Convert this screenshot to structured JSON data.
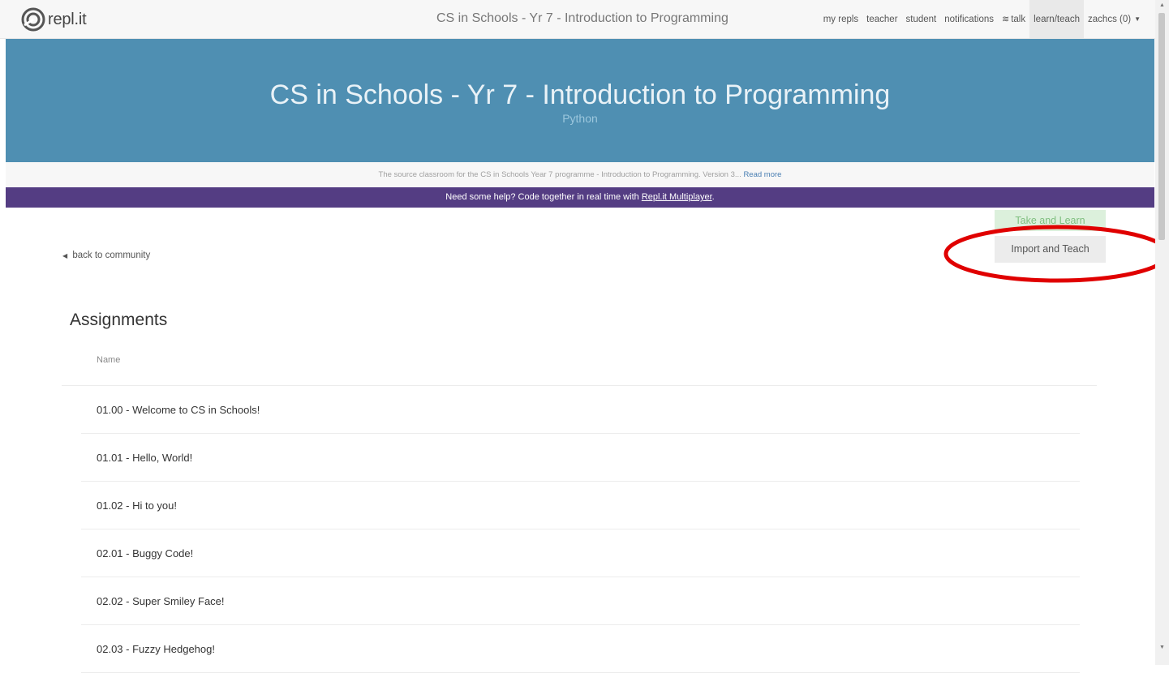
{
  "nav": {
    "logo_text": "repl.it",
    "title": "CS in Schools - Yr 7 - Introduction to Programming",
    "links": [
      {
        "label": "my repls"
      },
      {
        "label": "teacher"
      },
      {
        "label": "student"
      },
      {
        "label": "notifications"
      },
      {
        "label": "talk",
        "icon": "people-icon"
      },
      {
        "label": "learn/teach",
        "active": true
      },
      {
        "label": "zachcs (0)",
        "icon": "caret-down-icon"
      }
    ]
  },
  "hero": {
    "title": "CS in Schools - Yr 7 - Introduction to Programming",
    "language": "Python",
    "background_color": "#4f8fb2"
  },
  "description": {
    "text": "The source classroom for the CS in Schools Year 7 programme - Introduction to Programming. Version 3...",
    "read_more": "Read more"
  },
  "banner": {
    "text": "Need some help? Code together in real time with ",
    "link": "Repl.it Multiplayer",
    "suffix": ".",
    "background_color": "#543d83"
  },
  "actions": {
    "take_and_learn": "Take and Learn",
    "import_and_teach": "Import and Teach",
    "highlight_color": "#e00000"
  },
  "back_link": "back to community",
  "assignments": {
    "title": "Assignments",
    "column_name": "Name",
    "items": [
      "01.00 - Welcome to CS in Schools!",
      "01.01 - Hello, World!",
      "01.02 - Hi to you!",
      "02.01 - Buggy Code!",
      "02.02 - Super Smiley Face!",
      "02.03 - Fuzzy Hedgehog!"
    ]
  }
}
